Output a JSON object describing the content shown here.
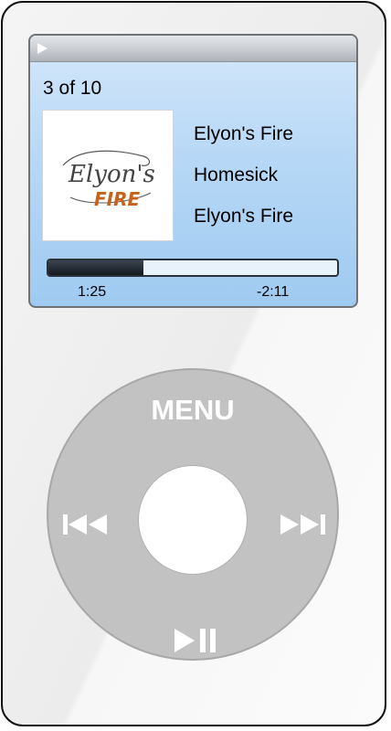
{
  "screen": {
    "track_position": "3 of 10",
    "song_title": "Elyon's Fire",
    "album": "Homesick",
    "artist": "Elyon's Fire",
    "album_art": {
      "logo_text_top": "Elyon's",
      "logo_text_bottom": "FIRE",
      "accent_color": "#c8621a"
    },
    "progress_fraction": 0.33,
    "elapsed_time": "1:25",
    "remaining_time": "-2:11",
    "status_icon": "play-icon"
  },
  "click_wheel": {
    "menu_label": "MENU",
    "icons": [
      "previous-track-icon",
      "next-track-icon",
      "play-pause-icon"
    ],
    "wheel_color": "#c2c2c2"
  }
}
